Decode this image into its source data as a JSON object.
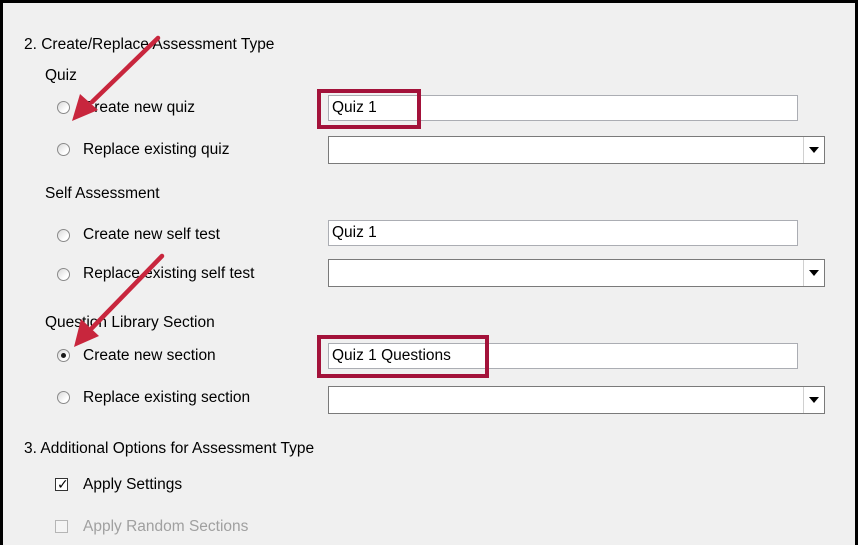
{
  "section2": {
    "heading": "2. Create/Replace Assessment Type",
    "quiz": {
      "group_label": "Quiz",
      "create_label": "Create new quiz",
      "create_value": "Quiz 1",
      "replace_label": "Replace existing quiz",
      "replace_value": ""
    },
    "self_assessment": {
      "group_label": "Self Assessment",
      "create_label": "Create new self test",
      "create_value": "Quiz 1",
      "replace_label": "Replace existing self test",
      "replace_value": ""
    },
    "question_library": {
      "group_label": "Question Library Section",
      "create_label": "Create new section",
      "create_value": "Quiz 1 Questions",
      "create_selected": true,
      "replace_label": "Replace existing section",
      "replace_value": ""
    }
  },
  "section3": {
    "heading": "3. Additional Options for Assessment Type",
    "apply_settings_label": "Apply Settings",
    "apply_settings_checked": true,
    "apply_random_label": "Apply Random Sections",
    "apply_random_enabled": false
  },
  "annotations": {
    "highlight_color": "#a3123a",
    "arrow_color": "#c8263d"
  }
}
